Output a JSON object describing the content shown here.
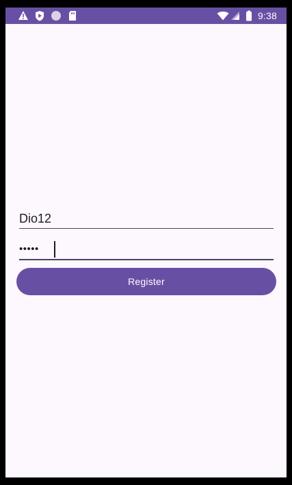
{
  "colors": {
    "accent": "#6750a4",
    "background": "#fdf7fe",
    "text": "#1d1b20",
    "divider": "#4a4458"
  },
  "status_bar": {
    "time": "9:38",
    "left_icons": [
      "warning-icon",
      "play-protect-icon",
      "circle-icon",
      "sd-card-icon"
    ],
    "right_icons": [
      "wifi-icon",
      "cell-signal-icon",
      "battery-icon"
    ]
  },
  "form": {
    "username": {
      "value": "Dio12"
    },
    "password": {
      "value": "•••••"
    },
    "register_label": "Register"
  }
}
